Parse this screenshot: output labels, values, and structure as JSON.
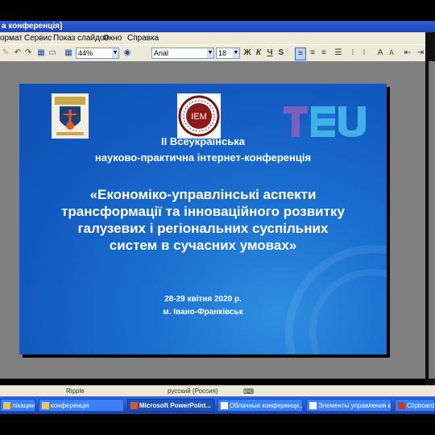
{
  "window": {
    "title": "а конференція]"
  },
  "menu": {
    "items": [
      "ормат",
      "Сервис",
      "Показ слайдов",
      "Окно",
      "Справка"
    ]
  },
  "toolbar": {
    "zoom": "44%",
    "font": "Arial",
    "size": "18",
    "bold": "Ж",
    "italic": "К",
    "underline": "Ч",
    "shadow": "S"
  },
  "slide": {
    "line1": "II Всеукраїнська",
    "line2": "науково-практична інтернет-конференція",
    "title1": "«Економіко-управлінські аспекти",
    "title2": "трансформації та інноваційного розвитку",
    "title3": "галузевих і регіональних суспільних",
    "title4": "систем в сучасних умовах»",
    "date": "28-29 квітня 2020 р.",
    "city": "м. Івано-Франківськ",
    "logo2_text": "IEM"
  },
  "status": {
    "design": "Ripple",
    "language": "русский (Россия)"
  },
  "taskbar": {
    "items": [
      "лікации - ...",
      "конференція",
      "Microsoft PowerPoint...",
      "Облачные конференци...",
      "Элементы управления к...",
      "ClipboardOv..."
    ]
  }
}
